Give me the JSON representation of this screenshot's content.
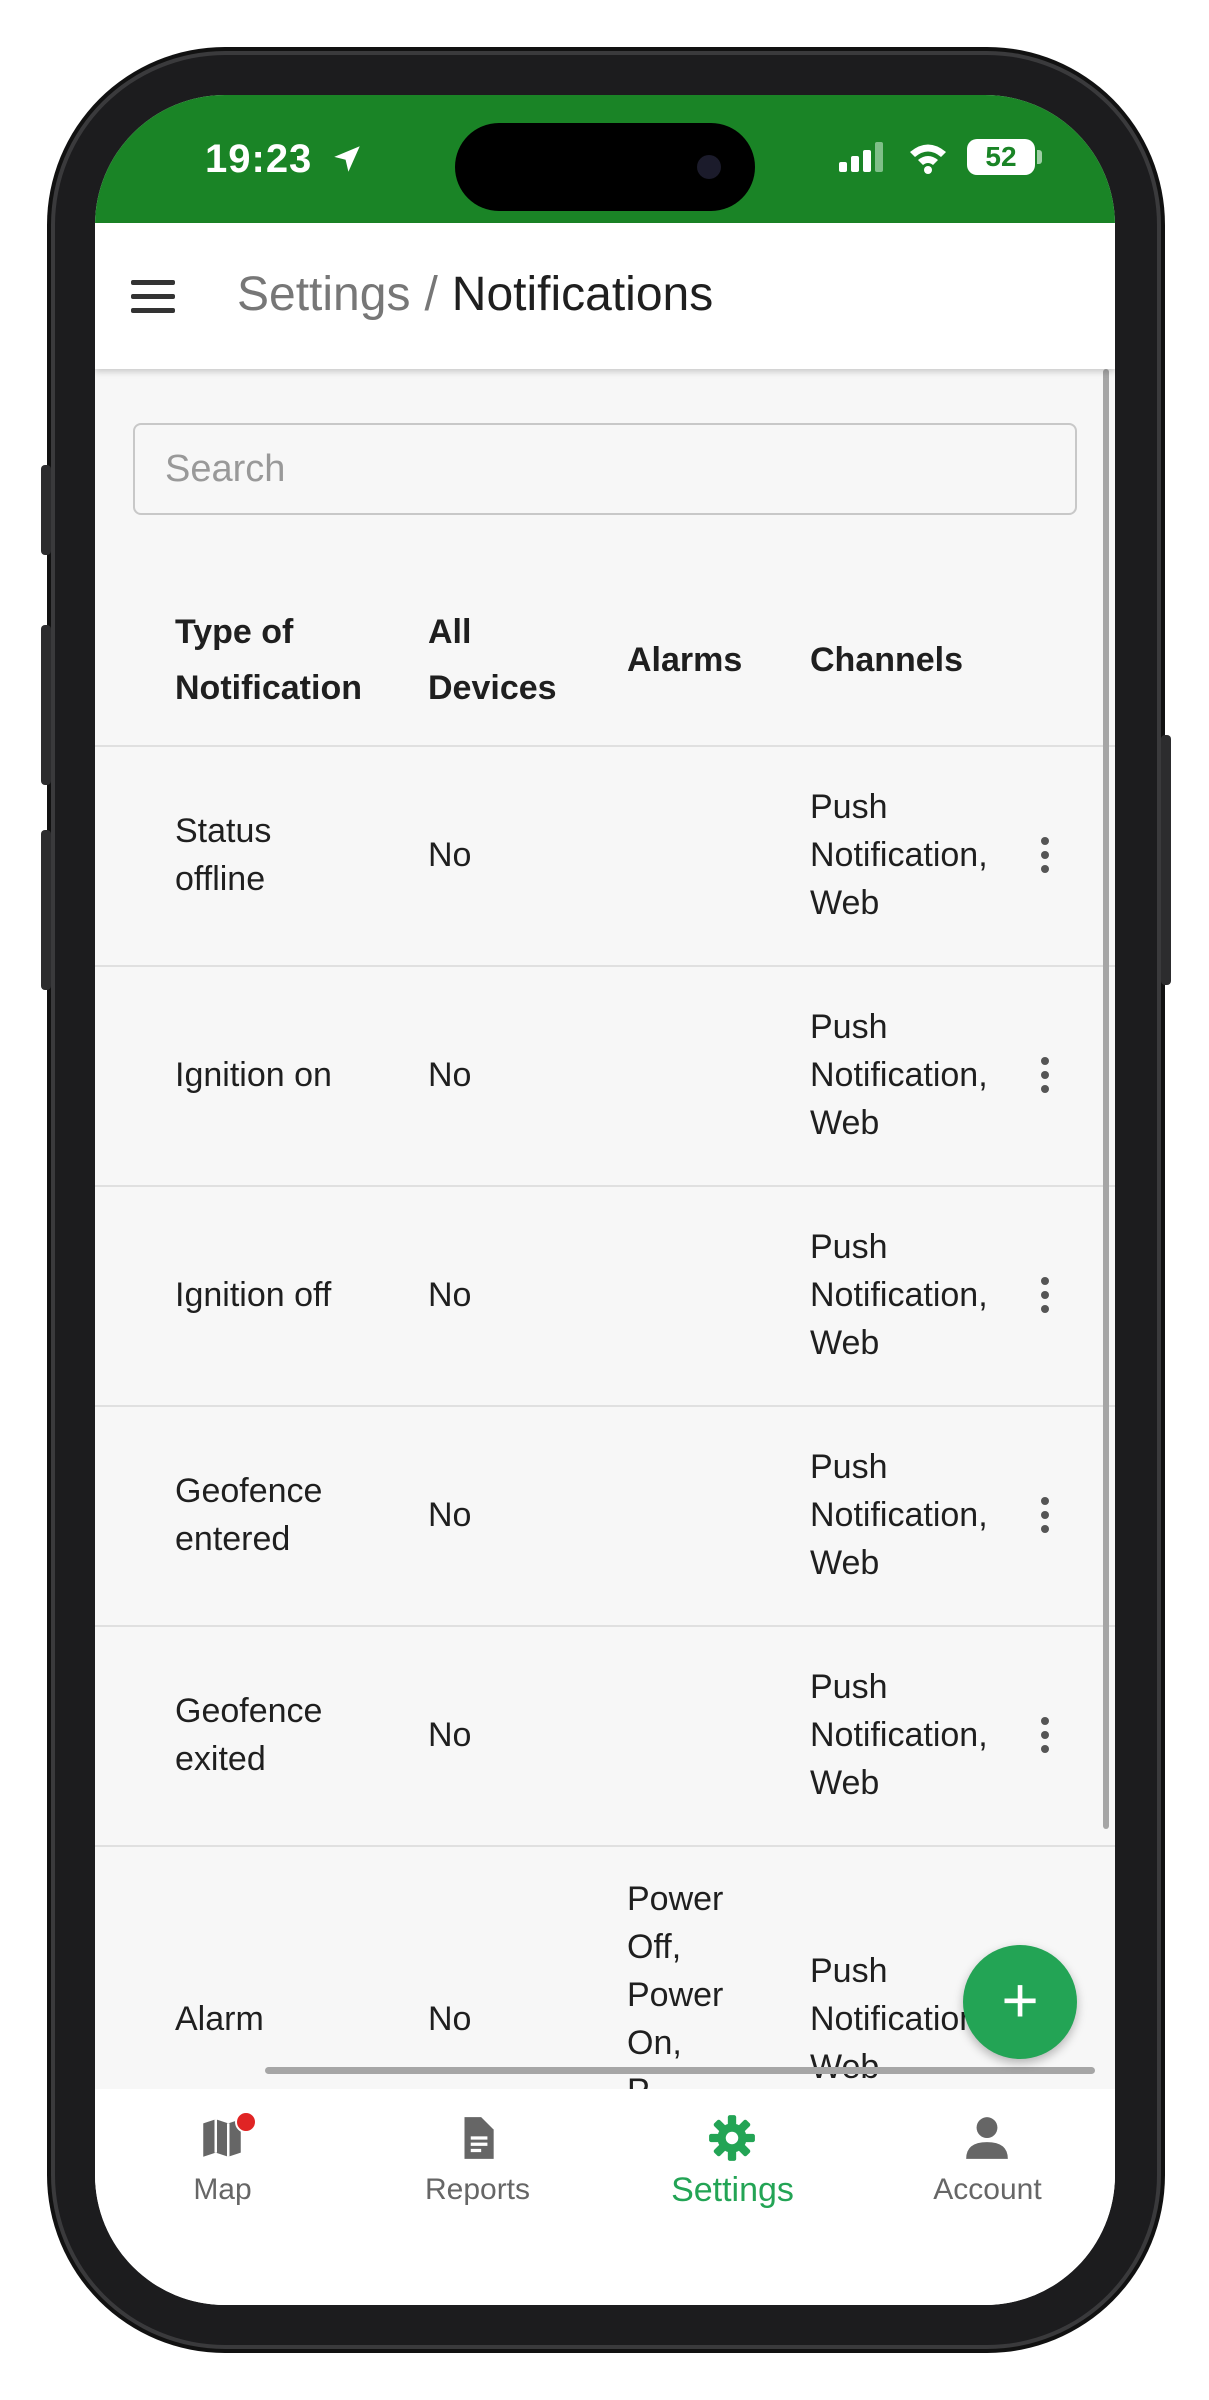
{
  "status_bar": {
    "time": "19:23",
    "battery": "52"
  },
  "header": {
    "parent": "Settings",
    "separator": "/",
    "current": "Notifications"
  },
  "search": {
    "placeholder": "Search",
    "value": ""
  },
  "table": {
    "columns": [
      {
        "line1": "Type of",
        "line2": "Notification"
      },
      {
        "line1": "All",
        "line2": "Devices"
      },
      {
        "label": "Alarms"
      },
      {
        "label": "Channels"
      }
    ],
    "rows": [
      {
        "type": [
          "Status",
          "offline"
        ],
        "all_devices": "No",
        "alarms": [],
        "channels": [
          "Push",
          "Notification,",
          "Web"
        ]
      },
      {
        "type": [
          "Ignition on"
        ],
        "all_devices": "No",
        "alarms": [],
        "channels": [
          "Push",
          "Notification,",
          "Web"
        ]
      },
      {
        "type": [
          "Ignition off"
        ],
        "all_devices": "No",
        "alarms": [],
        "channels": [
          "Push",
          "Notification,",
          "Web"
        ]
      },
      {
        "type": [
          "Geofence",
          "entered"
        ],
        "all_devices": "No",
        "alarms": [],
        "channels": [
          "Push",
          "Notification,",
          "Web"
        ]
      },
      {
        "type": [
          "Geofence",
          "exited"
        ],
        "all_devices": "No",
        "alarms": [],
        "channels": [
          "Push",
          "Notification,",
          "Web"
        ]
      },
      {
        "type": [
          "Alarm"
        ],
        "all_devices": "No",
        "alarms": [
          "Power",
          "Off,",
          "Power",
          "On,",
          "P..."
        ],
        "channels": [
          "Push",
          "Notification,",
          "Web"
        ]
      }
    ]
  },
  "fab": {
    "label": "+"
  },
  "bottom_nav": [
    {
      "label": "Map",
      "icon": "map-icon",
      "active": false,
      "badge": true
    },
    {
      "label": "Reports",
      "icon": "document-icon",
      "active": false,
      "badge": false
    },
    {
      "label": "Settings",
      "icon": "gear-icon",
      "active": true,
      "badge": false
    },
    {
      "label": "Account",
      "icon": "person-icon",
      "active": false,
      "badge": false
    }
  ],
  "colors": {
    "status_bar": "#1a8426",
    "accent": "#23a455",
    "badge": "#e02424"
  }
}
